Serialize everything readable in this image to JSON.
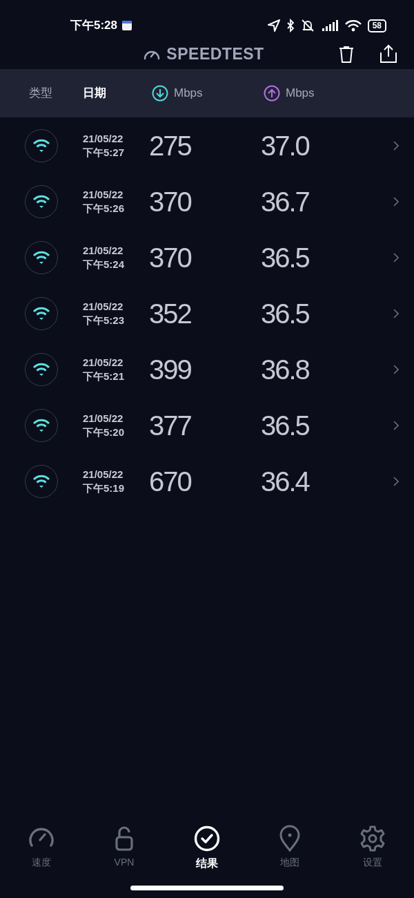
{
  "status_bar": {
    "time": "下午5:28",
    "battery": "58"
  },
  "header": {
    "title": "SPEEDTEST"
  },
  "columns": [
    {
      "label": "类型",
      "kind": "text",
      "selected": false
    },
    {
      "label": "日期",
      "kind": "text",
      "selected": true
    },
    {
      "label": "Mbps",
      "kind": "download",
      "selected": false
    },
    {
      "label": "Mbps",
      "kind": "upload",
      "selected": false
    }
  ],
  "results": [
    {
      "date": "21/05/22",
      "time": "下午5:27",
      "download": "275",
      "upload": "37.0"
    },
    {
      "date": "21/05/22",
      "time": "下午5:26",
      "download": "370",
      "upload": "36.7"
    },
    {
      "date": "21/05/22",
      "time": "下午5:24",
      "download": "370",
      "upload": "36.5"
    },
    {
      "date": "21/05/22",
      "time": "下午5:23",
      "download": "352",
      "upload": "36.5"
    },
    {
      "date": "21/05/22",
      "time": "下午5:21",
      "download": "399",
      "upload": "36.8"
    },
    {
      "date": "21/05/22",
      "time": "下午5:20",
      "download": "377",
      "upload": "36.5"
    },
    {
      "date": "21/05/22",
      "time": "下午5:19",
      "download": "670",
      "upload": "36.4"
    }
  ],
  "tabs": [
    {
      "label": "速度",
      "kind": "speed",
      "selected": false
    },
    {
      "label": "VPN",
      "kind": "vpn",
      "selected": false
    },
    {
      "label": "结果",
      "kind": "results",
      "selected": true
    },
    {
      "label": "地图",
      "kind": "map",
      "selected": false
    },
    {
      "label": "设置",
      "kind": "settings",
      "selected": false
    }
  ]
}
